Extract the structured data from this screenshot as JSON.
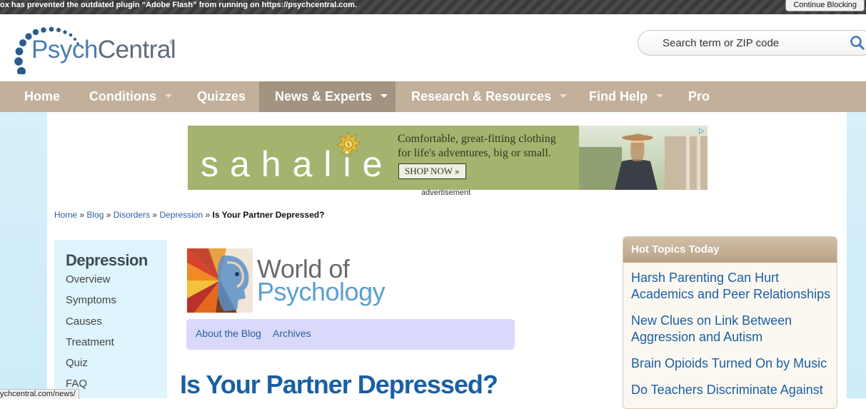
{
  "plugin_bar": {
    "message": "ox has prevented the outdated plugin “Adobe Flash” from running on https://psychcentral.com.",
    "button": "Continue Blocking"
  },
  "header": {
    "logo_text_a": "Psych",
    "logo_text_b": "Central",
    "logo_reg": "®",
    "search_placeholder": "Search term or ZIP code"
  },
  "nav": {
    "items": [
      {
        "label": "Home",
        "dropdown": false
      },
      {
        "label": "Conditions",
        "dropdown": true
      },
      {
        "label": "Quizzes",
        "dropdown": false
      },
      {
        "label": "News & Experts",
        "dropdown": true,
        "active": true
      },
      {
        "label": "Research & Resources",
        "dropdown": true
      },
      {
        "label": "Find Help",
        "dropdown": true
      },
      {
        "label": "Pro",
        "dropdown": false
      }
    ]
  },
  "ad": {
    "brand": "sahalie",
    "tagline_1": "Comfortable, great-fitting clothing",
    "tagline_2": "for life's adventures, big or small.",
    "cta": "SHOP NOW »",
    "caption": "advertisement",
    "colors": {
      "background": "#a4b36e"
    }
  },
  "breadcrumb": {
    "items": [
      "Home",
      "Blog",
      "Disorders",
      "Depression"
    ],
    "separator": " » ",
    "current": "Is Your Partner Depressed?"
  },
  "sidebar": {
    "title": "Depression",
    "links": [
      "Overview",
      "Symptoms",
      "Causes",
      "Treatment",
      "Quiz",
      "FAQ"
    ]
  },
  "blog": {
    "name_line1": "World of",
    "name_line2": "Psychology",
    "tabs": [
      "About the Blog",
      "Archives"
    ]
  },
  "post": {
    "title": "Is Your Partner Depressed?"
  },
  "hot_topics": {
    "header": "Hot Topics Today",
    "items": [
      "Harsh Parenting Can Hurt Academics and Peer Relationships",
      "New Clues on Link Between Aggression and Autism",
      "Brain Opioids Turned On by Music",
      "Do Teachers Discriminate Against"
    ]
  },
  "status_bar": {
    "url": "ychcentral.com/news/"
  },
  "colors": {
    "nav_bg": "#c2b09b",
    "nav_active": "#a29481",
    "link": "#1a5fa3",
    "sidebar_bg": "#def5fd",
    "blog_tabs_bg": "#d9d9fb"
  }
}
